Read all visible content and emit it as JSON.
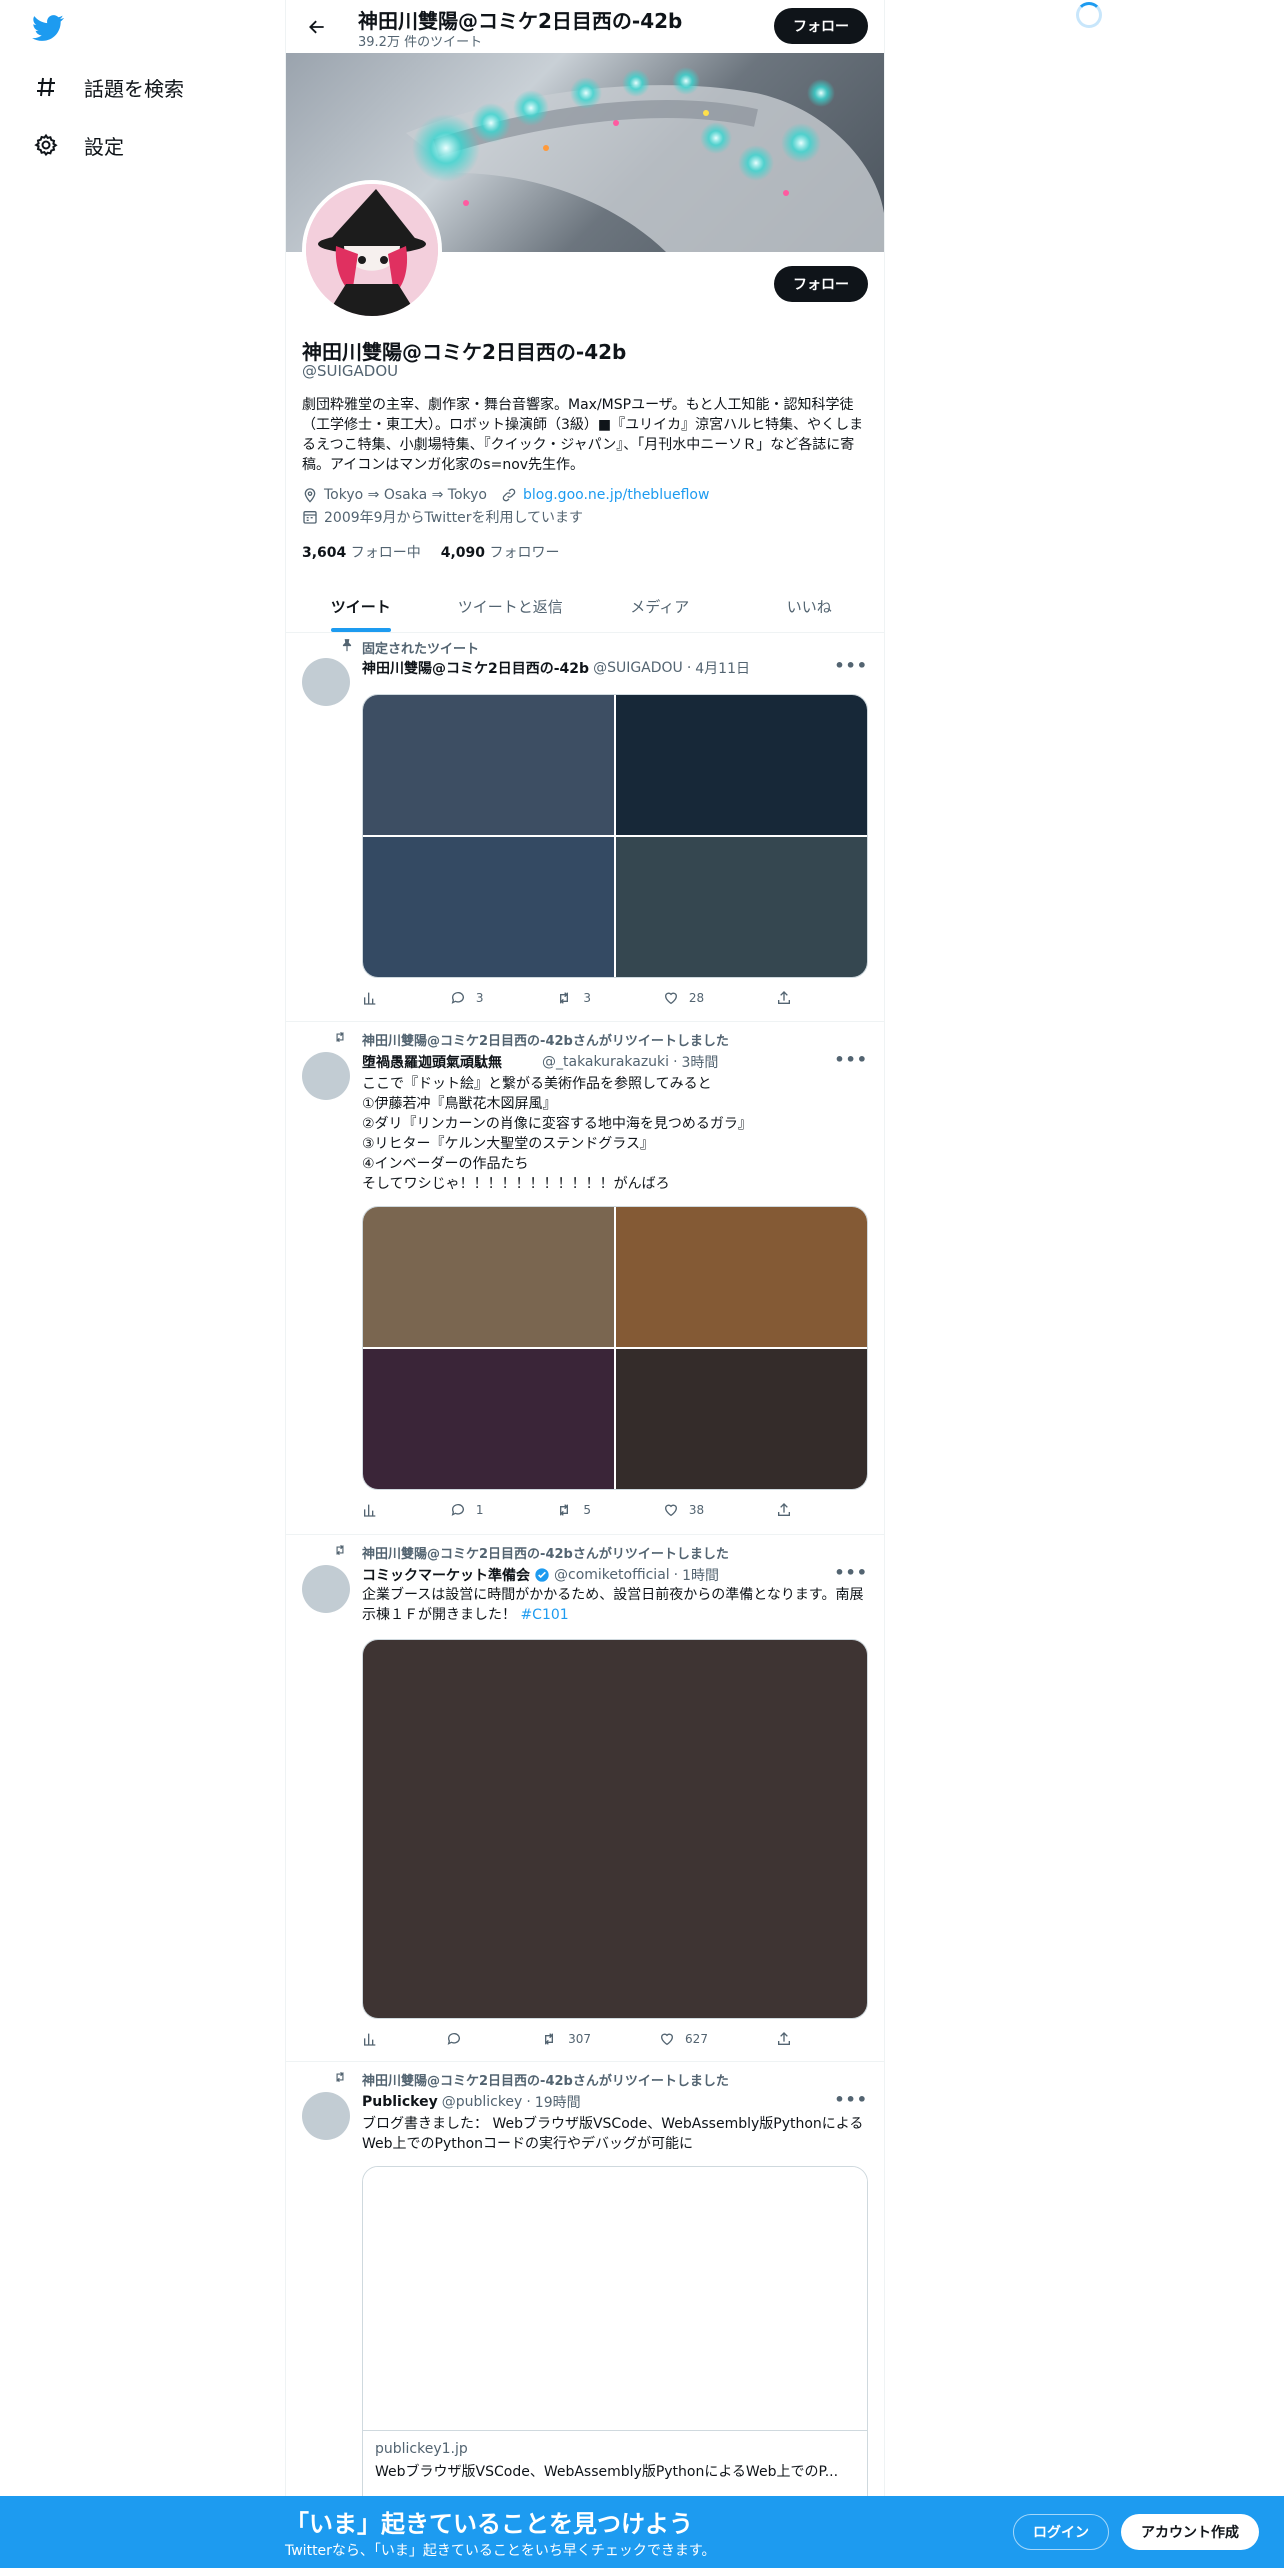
{
  "colors": {
    "brand": "#1d9bf0",
    "text": "#0f1419",
    "muted": "#536471"
  },
  "sidebar": {
    "logo": "twitter-bird-icon",
    "items": [
      {
        "icon": "hashtag-icon",
        "label": "話題を検索"
      },
      {
        "icon": "gear-icon",
        "label": "設定"
      }
    ]
  },
  "header": {
    "name": "神田川雙陽@コミケ2日目西の-42b",
    "tweet_count": "39.2万 件のツイート",
    "follow_label": "フォロー"
  },
  "profile": {
    "name": "神田川雙陽@コミケ2日目西の-42b",
    "handle": "@SUIGADOU",
    "bio": "劇団粋雅堂の主宰、劇作家・舞台音響家。Max/MSPユーザ。もと人工知能・認知科学徒（工学修士・東工大）。ロボット操演師（3級）■『ユリイカ』涼宮ハルヒ特集、やくしまるえつこ特集、小劇場特集、『クイック・ジャパン』、「月刊水中ニーソＲ」など各誌に寄稿。アイコンはマンガ化家のs=nov先生作。",
    "location": "Tokyo ⇒ Osaka ⇒ Tokyo",
    "website": "blog.goo.ne.jp/theblueflow",
    "joined": "2009年9月からTwitterを利用しています",
    "following_count": "3,604",
    "following_label": "フォロー中",
    "followers_count": "4,090",
    "followers_label": "フォロワー",
    "follow_label": "フォロー"
  },
  "tabs": [
    {
      "label": "ツイート",
      "active": true
    },
    {
      "label": "ツイートと返信",
      "active": false
    },
    {
      "label": "メディア",
      "active": false
    },
    {
      "label": "いいね",
      "active": false
    }
  ],
  "tweets": [
    {
      "context": "固定されたツイート",
      "name": "神田川雙陽@コミケ2日目西の-42b",
      "handle": "@SUIGADOU",
      "time": "4月11日",
      "text": "",
      "media_colors": [
        "#3d4e63",
        "#172838",
        "#344a63",
        "#354750"
      ],
      "replies": "3",
      "retweets": "3",
      "likes": "28"
    },
    {
      "context": "神田川雙陽@コミケ2日目西の-42bさんがリツイートしました",
      "name": "堕禍愚羅迦頭氣頑駄無",
      "handle": "@_takakurakazuki",
      "time": "3時間",
      "text": "ここで『ドット絵』と繋がる美術作品を参照してみると\n①伊藤若冲『鳥獣花木図屏風』\n②ダリ『リンカーンの肖像に変容する地中海を見つめるガラ』\n③リヒター『ケルン大聖堂のステンドグラス』\n④インベーダーの作品たち\nそしてワシじゃ！！！！！！！！！！！がんばろ",
      "media_colors": [
        "#7a6650",
        "#845a35",
        "#3a2538",
        "#342c2a"
      ],
      "replies": "1",
      "retweets": "5",
      "likes": "38"
    },
    {
      "context": "神田川雙陽@コミケ2日目西の-42bさんがリツイートしました",
      "name": "コミックマーケット準備会",
      "handle": "@comiketofficial",
      "time": "1時間",
      "text": "企業ブースは設営に時間がかかるため、設営日前夜からの準備となります。南展示棟１Ｆが開きました！ ",
      "hashtag": "#C101",
      "media_colors": [
        "#3e3433"
      ],
      "replies": "",
      "retweets": "307",
      "likes": "627"
    },
    {
      "context": "神田川雙陽@コミケ2日目西の-42bさんがリツイートしました",
      "name": "Publickey",
      "handle": "@publickey",
      "time": "19時間",
      "text": "ブログ書きました： Webブラウザ版VSCode、WebAssembly版PythonによるWeb上でのPythonコードの実行やデバッグが可能に",
      "card_domain": "publickey1.jp",
      "card_title": "Webブラウザ版VSCode、WebAssembly版PythonによるWeb上でのP..."
    }
  ],
  "bottom_bar": {
    "title": "「いま」起きていることを見つけよう",
    "subtitle": "Twitterなら、「いま」起きていることをいち早くチェックできます。",
    "login": "ログイン",
    "signup": "アカウント作成"
  }
}
